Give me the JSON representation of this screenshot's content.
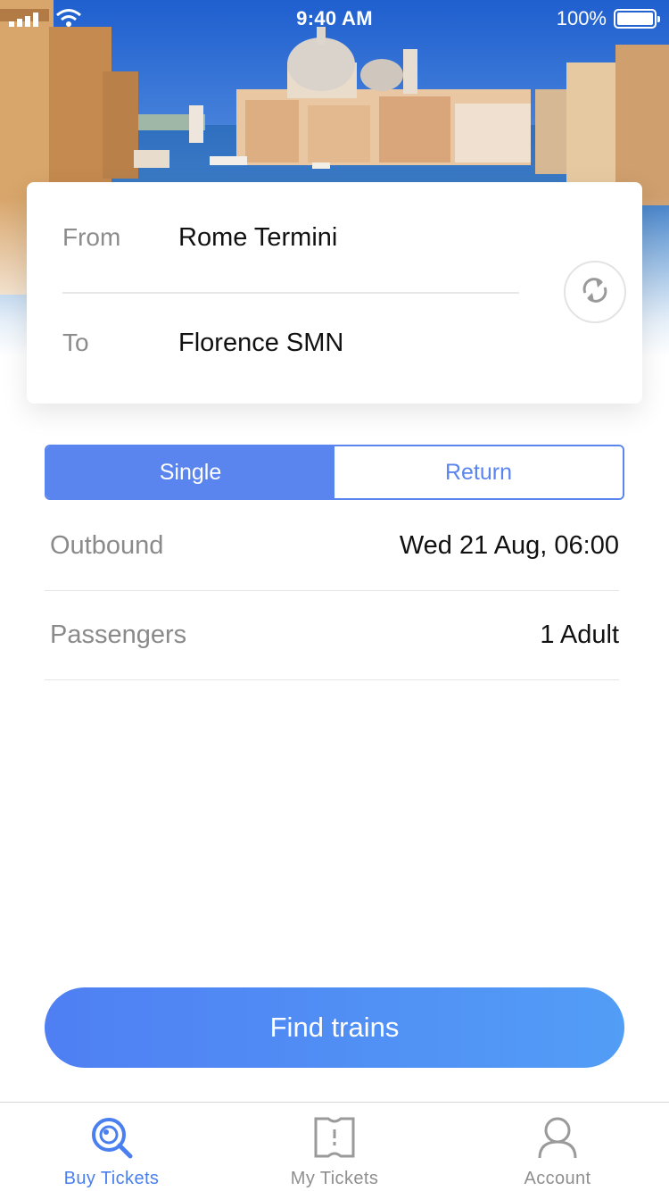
{
  "status_bar": {
    "time": "9:40 AM",
    "battery_percent": "100%"
  },
  "hero": {
    "icon": "venice-grand-canal-photo"
  },
  "route": {
    "from_label": "From",
    "from_value": "Rome Termini",
    "to_label": "To",
    "to_value": "Florence SMN",
    "swap_icon": "swap-arrows-icon"
  },
  "trip_type": {
    "options": [
      "Single",
      "Return"
    ],
    "selected": "Single"
  },
  "outbound": {
    "label": "Outbound",
    "value": "Wed 21 Aug, 06:00"
  },
  "passengers": {
    "label": "Passengers",
    "value": "1 Adult"
  },
  "actions": {
    "find_trains": "Find trains"
  },
  "tabbar": {
    "items": [
      {
        "label": "Buy Tickets",
        "icon": "search-ticket-icon",
        "active": true
      },
      {
        "label": "My Tickets",
        "icon": "ticket-icon",
        "active": false
      },
      {
        "label": "Account",
        "icon": "person-icon",
        "active": false
      }
    ]
  },
  "colors": {
    "accent": "#5b85ee",
    "button_gradient_start": "#4f7ff3",
    "button_gradient_end": "#529df6",
    "active_tab": "#4a7ff0"
  }
}
